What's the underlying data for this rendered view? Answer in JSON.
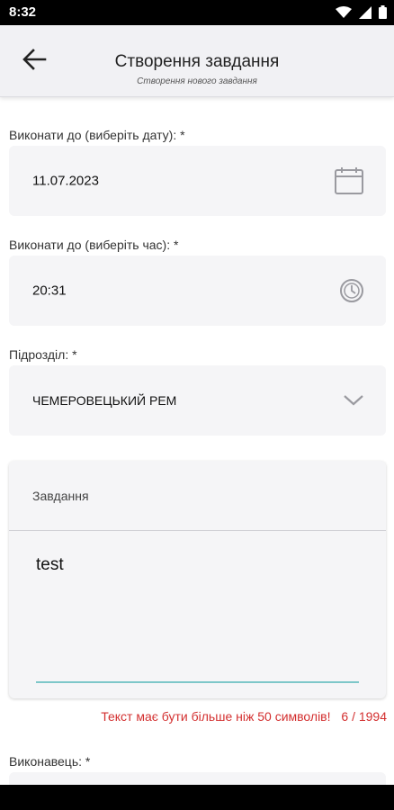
{
  "status_bar": {
    "time": "8:32",
    "icons": [
      "wifi-icon",
      "signal-icon",
      "battery-icon"
    ]
  },
  "app_bar": {
    "back_icon": "arrow-back-icon",
    "title": "Створення завдання",
    "subtitle": "Створення нового завдання"
  },
  "form": {
    "date": {
      "label": "Виконати до (виберіть дату): *",
      "value": "11.07.2023",
      "icon": "calendar-icon"
    },
    "time": {
      "label": "Виконати до (виберіть час): *",
      "value": "20:31",
      "icon": "clock-icon"
    },
    "department": {
      "label": "Підрозділ: *",
      "value": "ЧЕМЕРОВЕЦЬКИЙ РЕМ",
      "icon": "chevron-down-icon"
    },
    "task": {
      "title": "Завдання",
      "value": "test",
      "error": "Текст має бути більше ніж 50 символів!",
      "counter": "6 / 1994"
    },
    "executor": {
      "label": "Виконавець: *"
    }
  },
  "colors": {
    "error": "#d32f2f",
    "underline": "#7ec7c9",
    "field_bg": "#f5f5f7",
    "appbar_bg": "#f1f1f4"
  }
}
